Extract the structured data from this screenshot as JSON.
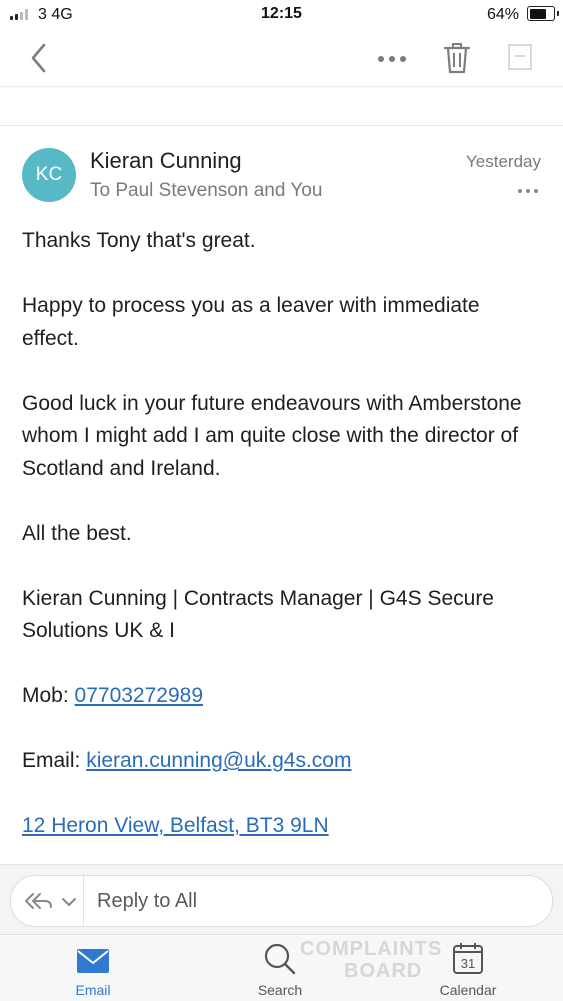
{
  "status_bar": {
    "carrier": "3  4G",
    "time": "12:15",
    "battery_percent": "64%",
    "battery_level": 0.64
  },
  "toolbar": {
    "back_icon": "chevron-left-icon",
    "more_icon": "more-horizontal-icon",
    "delete_icon": "trash-icon",
    "archive_icon": "archive-icon"
  },
  "message": {
    "avatar_initials": "KC",
    "avatar_color": "#57b8c6",
    "sender": "Kieran Cunning",
    "recipients": "To Paul Stevenson and You",
    "date": "Yesterday",
    "paragraphs": [
      "Thanks Tony that's great.",
      "Happy to process you as a leaver with immediate effect.",
      "Good luck in your future endeavours with Amberstone whom I might add I am quite close with the director of Scotland and Ireland.",
      "All the best.",
      "Kieran Cunning | Contracts Manager | G4S Secure Solutions UK & I"
    ],
    "mob_label": "Mob: ",
    "mob_value": "07703272989",
    "email_label": "Email: ",
    "email_value": "kieran.cunning@uk.g4s.com",
    "address": "12 Heron View, Belfast, BT3 9LN",
    "link_color": "#2b6cb8"
  },
  "reply": {
    "placeholder": "Reply to All",
    "icon": "reply-all-icon"
  },
  "tabs": [
    {
      "label": "Email",
      "icon": "envelope-icon",
      "active": true,
      "color": "#2f7ad0"
    },
    {
      "label": "Search",
      "icon": "search-icon",
      "active": false,
      "color": "#555555"
    },
    {
      "label": "Calendar",
      "icon": "calendar-icon",
      "active": false,
      "color": "#555555",
      "day": "31"
    }
  ],
  "watermark": [
    "COMPLAINTS",
    "BOARD"
  ]
}
